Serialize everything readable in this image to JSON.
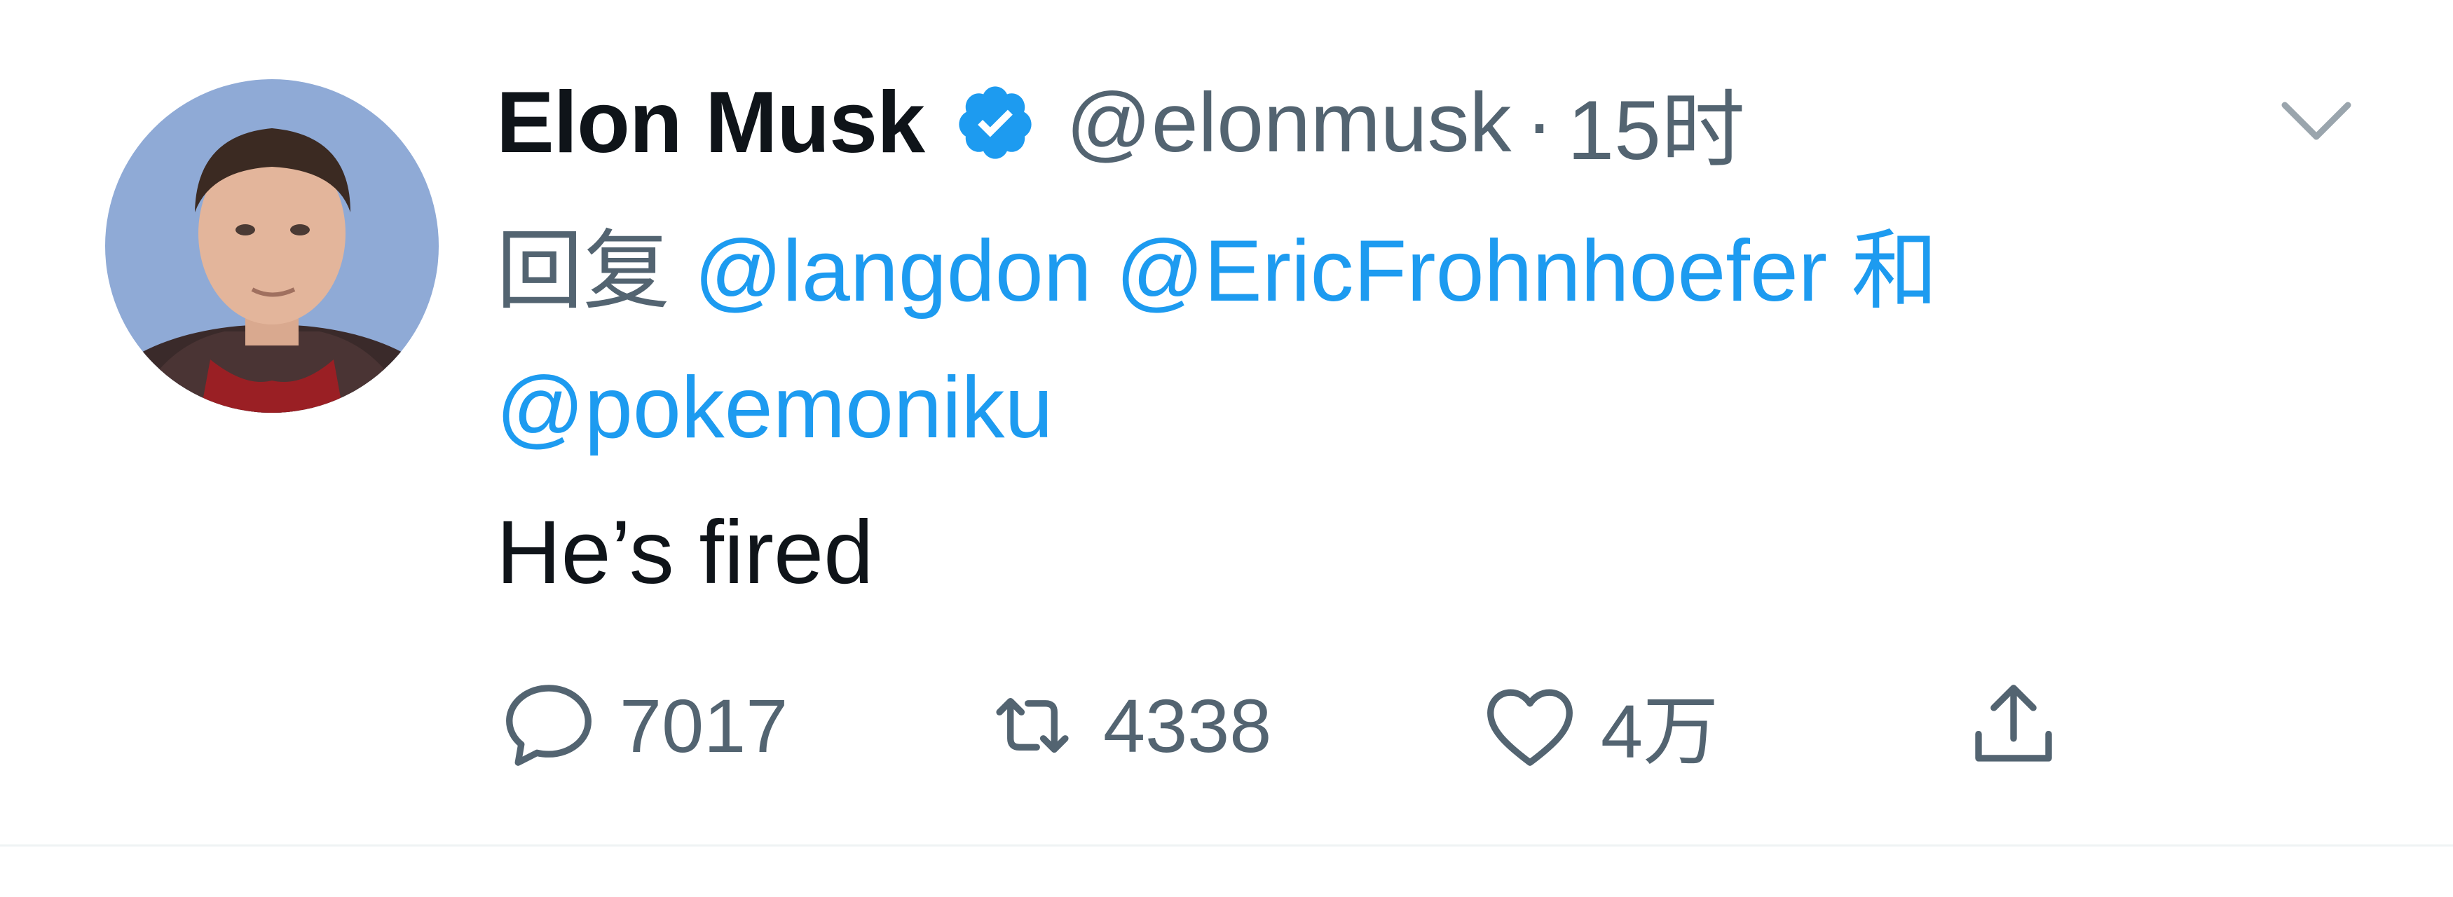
{
  "tweet": {
    "author": {
      "display_name": "Elon Musk",
      "handle": "@elonmusk",
      "verified": true,
      "avatar_icon": "profile-photo"
    },
    "separator": "·",
    "time": "15时",
    "reply_to": {
      "prefix": "回复",
      "mentions": [
        "@langdon",
        "@EricFrohnhoefer",
        "@pokemoniku"
      ],
      "conjunction": "和"
    },
    "text": "He’s fired",
    "actions": {
      "reply_count": "7017",
      "retweet_count": "4338",
      "like_count": "4万",
      "share_icon": "share-icon"
    },
    "menu_icon": "chevron-down-icon"
  },
  "colors": {
    "text_primary": "#0f1419",
    "text_secondary": "#536471",
    "mention": "#1d9bf0",
    "verified": "#1d9bf0"
  }
}
